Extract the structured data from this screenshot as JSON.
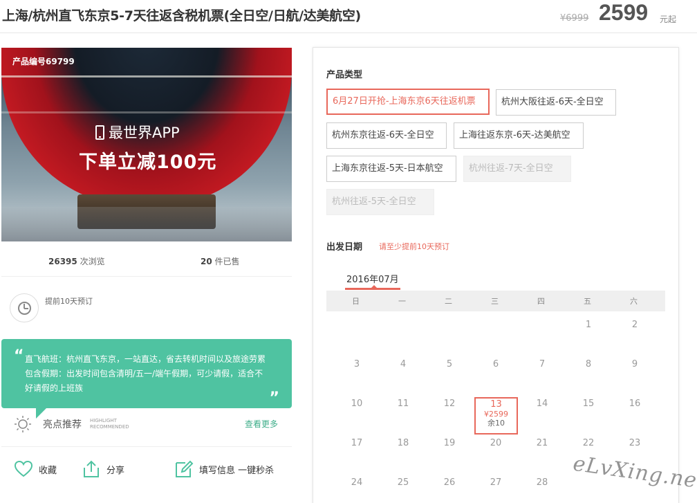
{
  "header": {
    "title": "上海/杭州直飞东京5-7天往返含税机票(全日空/日航/达美航空)",
    "original_price": "¥6999",
    "price": "2599",
    "price_suffix": "元起"
  },
  "hero": {
    "product_no": "产品编号69799",
    "app_text": "最世界APP",
    "promo_text": "下单立减100元"
  },
  "stats": {
    "views_count": "26395",
    "views_label": "次浏览",
    "sold_count": "20",
    "sold_label": "件已售"
  },
  "advance": {
    "text": "提前10天预订"
  },
  "highlight": {
    "open_quote": "“",
    "close_quote": "”",
    "line1": "直飞航班：杭州直飞东京，一站直达，省去转机时间以及旅途劳累",
    "line2": "包含假期：出发时间包含清明/五一/端午假期，可少请假，适合不",
    "line3": "好请假的上班族",
    "title": "亮点推荐",
    "en_line1": "HIGHLIGHT",
    "en_line2": "RECOMMENDED",
    "more": "查看更多"
  },
  "actions": {
    "favorite": "收藏",
    "share": "分享",
    "fill_info": "填写信息 一键秒杀"
  },
  "product_type": {
    "title": "产品类型",
    "options": [
      {
        "label": "6月27日开抢-上海东京6天往返机票",
        "state": "selected"
      },
      {
        "label": "杭州大阪往返-6天-全日空",
        "state": "normal"
      },
      {
        "label": "杭州东京往返-6天-全日空",
        "state": "normal"
      },
      {
        "label": "上海往返东京-6天-达美航空",
        "state": "normal"
      },
      {
        "label": "上海东京往返-5天-日本航空",
        "state": "normal"
      },
      {
        "label": "杭州往返-7天-全日空",
        "state": "disabled"
      },
      {
        "label": "杭州往返-5天-全日空",
        "state": "disabled"
      }
    ]
  },
  "departure": {
    "title": "出发日期",
    "hint": "请至少提前10天预订",
    "month": "2016年07月",
    "weekdays": [
      "日",
      "一",
      "二",
      "三",
      "四",
      "五",
      "六"
    ],
    "days_row1": [
      "1",
      "2"
    ],
    "days_row2": [
      "3",
      "4",
      "5",
      "6",
      "7",
      "8",
      "9"
    ],
    "days_row3": [
      "10",
      "11",
      "12",
      "14",
      "15",
      "16"
    ],
    "days_row4": [
      "17",
      "18",
      "19",
      "20",
      "21",
      "22",
      "23"
    ],
    "days_row5": [
      "24",
      "25",
      "26",
      "27",
      "28"
    ],
    "selected_day": {
      "day": "13",
      "price": "¥2599",
      "left": "余10"
    }
  },
  "colors": {
    "accent": "#e8675a",
    "green": "#4fc3a1"
  },
  "watermark": "eLvXing.net"
}
